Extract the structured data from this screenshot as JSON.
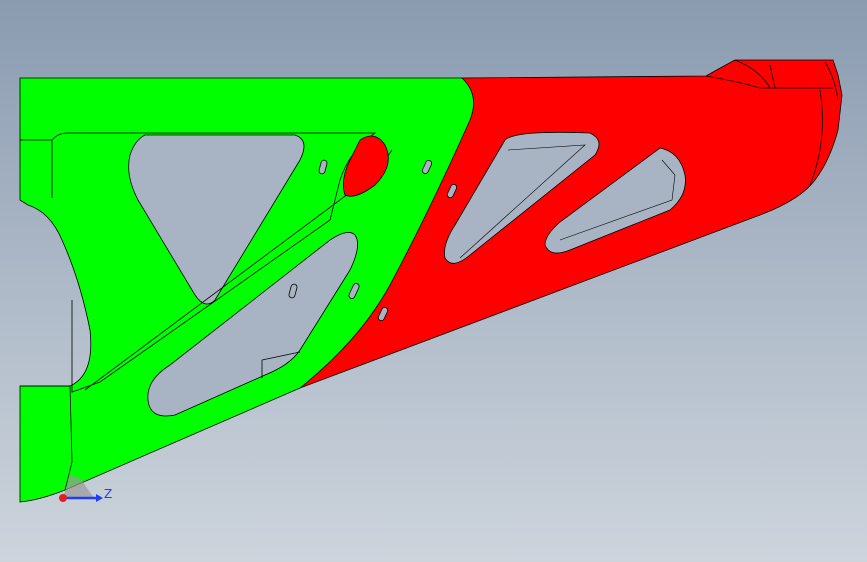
{
  "viewport": {
    "background_top": "#8a9bb0",
    "background_bottom": "#cdd4dc"
  },
  "part": {
    "green_region_color": "#00ff00",
    "red_region_color": "#ff0000",
    "edge_color": "#000000"
  },
  "triad": {
    "axis_label": "Z",
    "z_axis_color": "#1e3cff",
    "origin_color": "#e02020"
  }
}
